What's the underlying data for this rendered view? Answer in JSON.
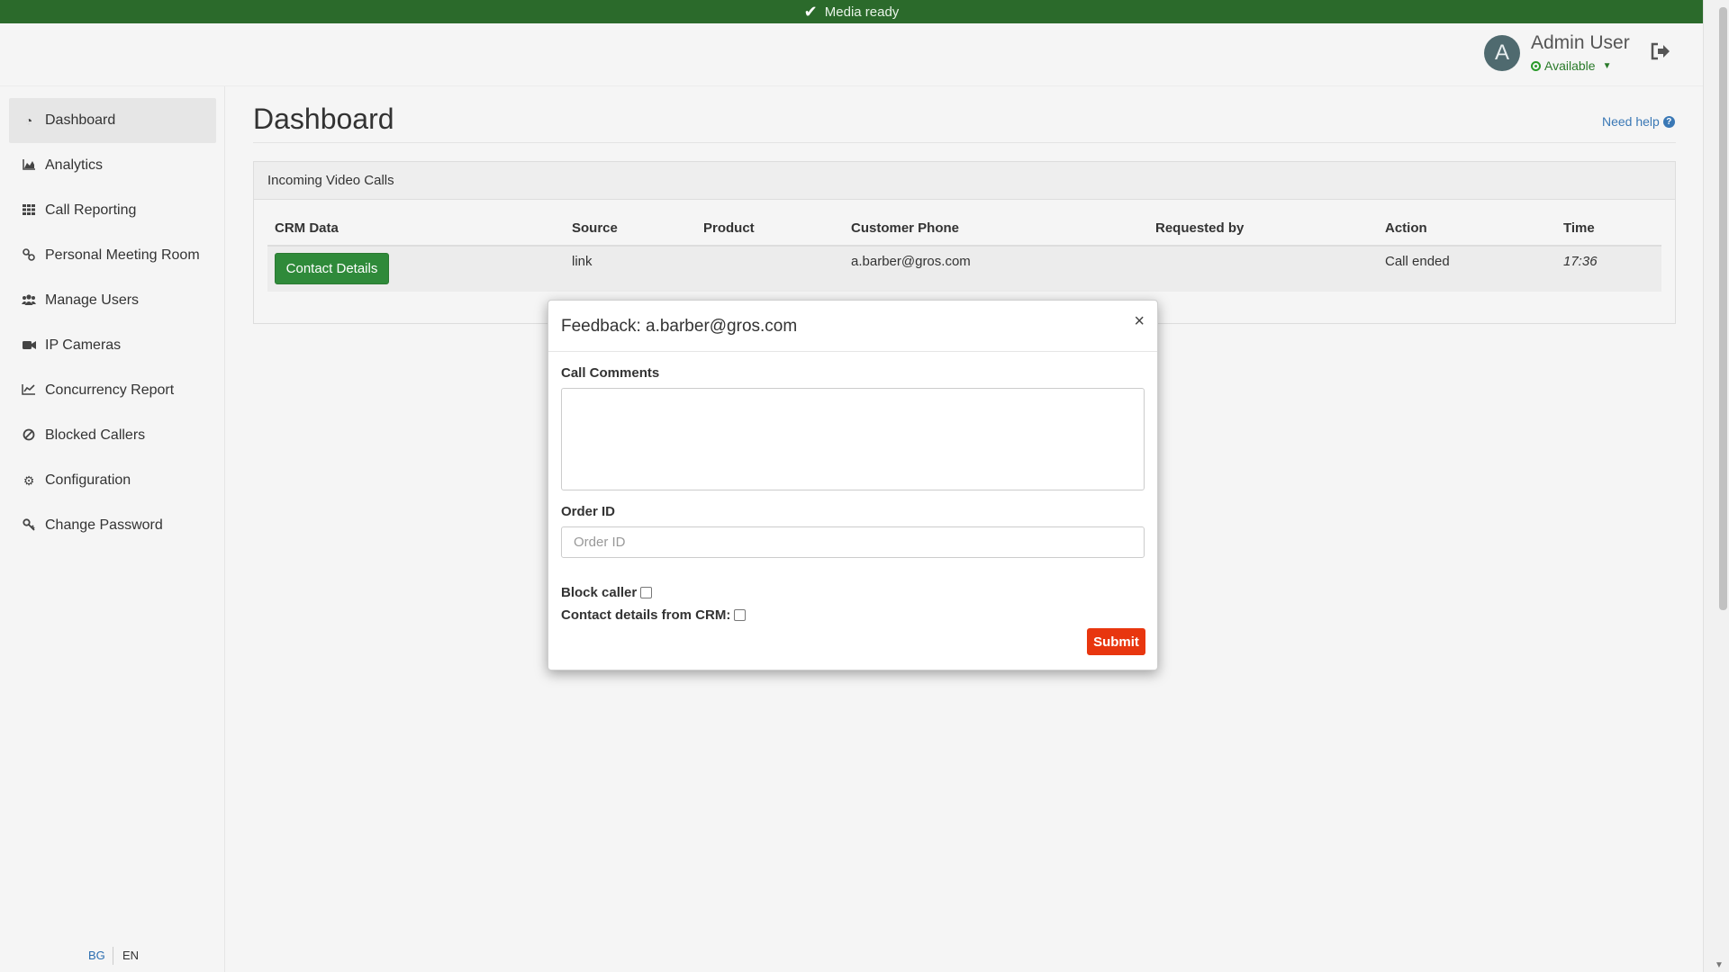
{
  "banner": {
    "text": "Media ready",
    "icon": "check-icon"
  },
  "header": {
    "avatar_letter": "A",
    "user_name": "Admin User",
    "status": "Available",
    "logout_icon": "logout-icon"
  },
  "sidebar": {
    "items": [
      {
        "label": "Dashboard",
        "icon": "dashboard-icon",
        "active": true
      },
      {
        "label": "Analytics",
        "icon": "area-chart-icon"
      },
      {
        "label": "Call Reporting",
        "icon": "grid-icon"
      },
      {
        "label": "Personal Meeting Room",
        "icon": "link-icon"
      },
      {
        "label": "Manage Users",
        "icon": "users-icon"
      },
      {
        "label": "IP Cameras",
        "icon": "video-camera-icon"
      },
      {
        "label": "Concurrency Report",
        "icon": "line-chart-icon"
      },
      {
        "label": "Blocked Callers",
        "icon": "ban-icon"
      },
      {
        "label": "Configuration",
        "icon": "gear-icon"
      },
      {
        "label": "Change Password",
        "icon": "key-icon"
      }
    ],
    "languages": [
      "BG",
      "EN"
    ]
  },
  "main": {
    "title": "Dashboard",
    "need_help": "Need help",
    "panel": {
      "title": "Incoming Video Calls",
      "columns": [
        "CRM Data",
        "Source",
        "Product",
        "Customer Phone",
        "Requested by",
        "Action",
        "Time"
      ],
      "rows": [
        {
          "crm_button": "Contact Details",
          "source": "link",
          "product": "",
          "customer_phone": "a.barber@gros.com",
          "requested_by": "",
          "action": "Call ended",
          "time": "17:36"
        }
      ]
    }
  },
  "modal": {
    "title": "Feedback: a.barber@gros.com",
    "close": "×",
    "call_comments_label": "Call Comments",
    "call_comments_value": "",
    "order_id_label": "Order ID",
    "order_id_placeholder": "Order ID",
    "block_caller_label": "Block caller",
    "crm_contact_label": "Contact details from CRM:",
    "submit": "Submit"
  },
  "colors": {
    "banner": "#2b6a2b",
    "primary_button": "#2f8a3a",
    "submit_button": "#e8360f",
    "link": "#3a78b5"
  }
}
